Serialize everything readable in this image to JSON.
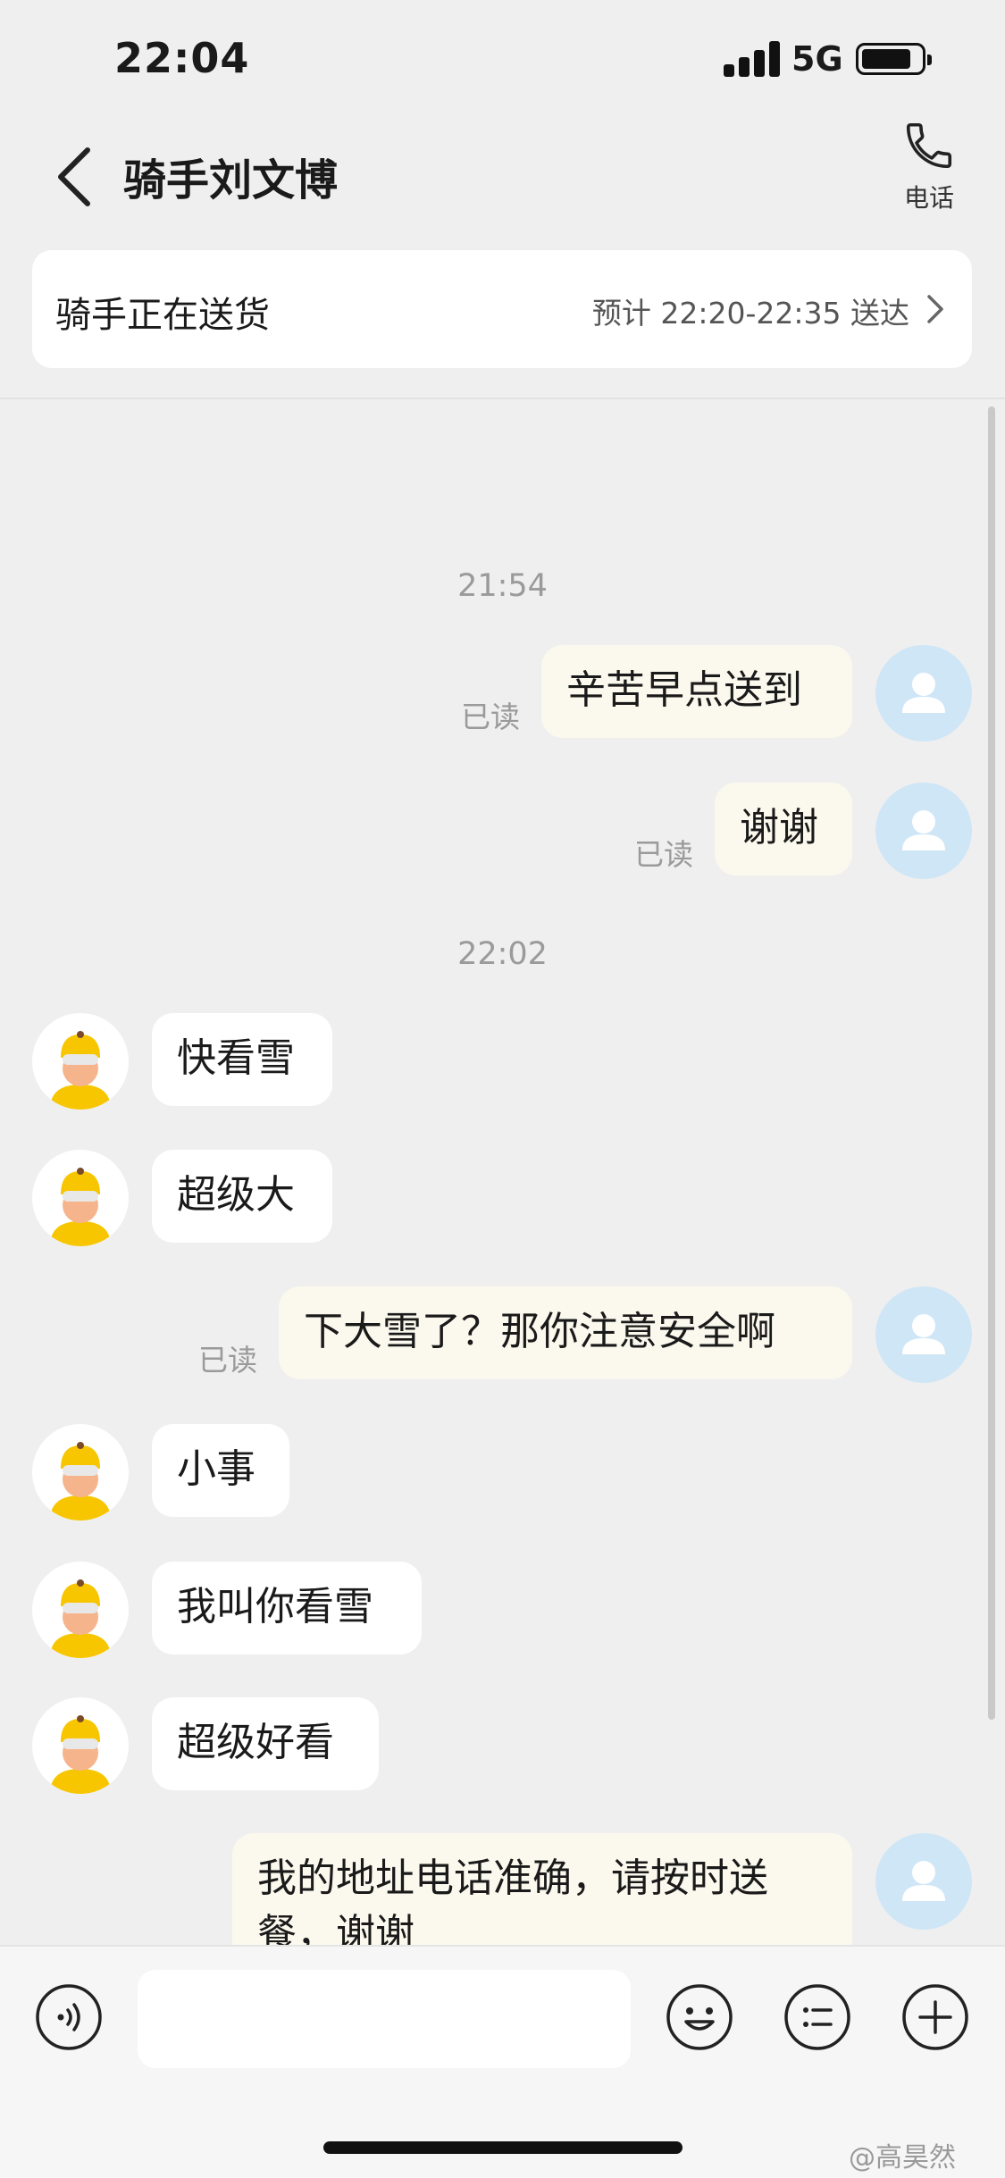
{
  "status_bar": {
    "time": "22:04",
    "network": "5G"
  },
  "header": {
    "back_icon": "chevron-left-icon",
    "title": "骑手刘文博",
    "phone_label": "电话",
    "phone_icon": "phone-icon"
  },
  "delivery_card": {
    "status": "骑手正在送货",
    "eta": "预计 22:20-22:35 送达"
  },
  "timestamps": [
    "21:54",
    "22:02"
  ],
  "read_label": "已读",
  "messages": [
    {
      "sender": "me",
      "text": "辛苦早点送到",
      "read": "已读"
    },
    {
      "sender": "me",
      "text": "谢谢",
      "read": "已读"
    },
    {
      "sender": "rider",
      "text": "快看雪"
    },
    {
      "sender": "rider",
      "text": "超级大"
    },
    {
      "sender": "me",
      "text": "下大雪了？那你注意安全啊",
      "read": "已读"
    },
    {
      "sender": "rider",
      "text": "小事"
    },
    {
      "sender": "rider",
      "text": "我叫你看雪"
    },
    {
      "sender": "rider",
      "text": "超级好看"
    },
    {
      "sender": "me",
      "text": "我的地址电话准确，请按时送",
      "text2": "餐，谢谢"
    }
  ],
  "input_bar": {
    "voice_icon": "voice-icon",
    "emoji_icon": "emoji-icon",
    "quick_reply_icon": "list-icon",
    "more_icon": "plus-icon"
  },
  "watermark": "@高昊然",
  "colors": {
    "background": "#efefef",
    "my_bubble": "#fbf9ee",
    "rider_bubble": "#ffffff",
    "user_avatar": "#cfe6f7",
    "rider_helmet": "#f7c600"
  }
}
